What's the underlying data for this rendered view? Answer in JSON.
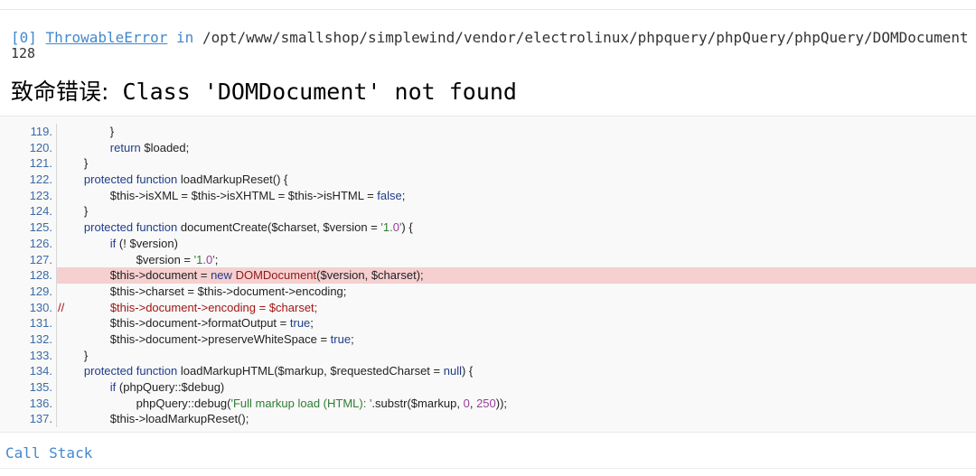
{
  "error": {
    "code": "[0]",
    "exception": "ThrowableError",
    "in_word": "in",
    "file_path": "/opt/www/smallshop/simplewind/vendor/electrolinux/phpquery/phpQuery/phpQuery/DOMDocument",
    "line": "128",
    "message_prefix": "致命错误:",
    "message": "Class 'DOMDocument' not found"
  },
  "source": {
    "highlight_line": "128.",
    "lines": [
      {
        "no": "119.",
        "text": "                }"
      },
      {
        "no": "120.",
        "text": "                return $loaded;"
      },
      {
        "no": "121.",
        "text": "        }"
      },
      {
        "no": "122.",
        "text": "        protected function loadMarkupReset() {"
      },
      {
        "no": "123.",
        "text": "                $this->isXML = $this->isXHTML = $this->isHTML = false;"
      },
      {
        "no": "124.",
        "text": "        }"
      },
      {
        "no": "125.",
        "text": "        protected function documentCreate($charset, $version = '1.0') {"
      },
      {
        "no": "126.",
        "text": "                if (! $version)"
      },
      {
        "no": "127.",
        "text": "                        $version = '1.0';"
      },
      {
        "no": "128.",
        "text": "                $this->document = new DOMDocument($version, $charset);"
      },
      {
        "no": "129.",
        "text": "                $this->charset = $this->document->encoding;"
      },
      {
        "no": "130.",
        "text": "//              $this->document->encoding = $charset;"
      },
      {
        "no": "131.",
        "text": "                $this->document->formatOutput = true;"
      },
      {
        "no": "132.",
        "text": "                $this->document->preserveWhiteSpace = true;"
      },
      {
        "no": "133.",
        "text": "        }"
      },
      {
        "no": "134.",
        "text": "        protected function loadMarkupHTML($markup, $requestedCharset = null) {"
      },
      {
        "no": "135.",
        "text": "                if (phpQuery::$debug)"
      },
      {
        "no": "136.",
        "text": "                        phpQuery::debug('Full markup load (HTML): '.substr($markup, 0, 250));"
      },
      {
        "no": "137.",
        "text": "                $this->loadMarkupReset();"
      }
    ]
  },
  "call_stack_label": "Call Stack",
  "colors": {
    "link_blue": "#4288ce",
    "highlight_bg": "#f6cfcf",
    "panel_bg": "#f9f9f9"
  }
}
